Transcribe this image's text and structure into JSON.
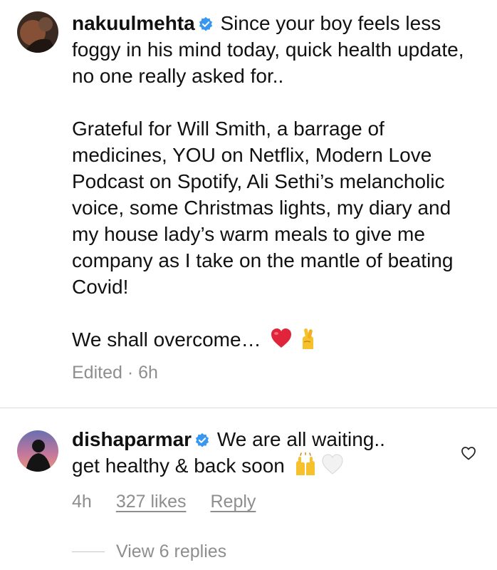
{
  "post": {
    "username": "nakuulmehta",
    "verified_icon": "verified-badge-icon",
    "caption_first": "Since your boy feels less foggy in his mind today, quick health update, no one really asked for..",
    "caption_second": "Grateful for Will Smith, a barrage of medicines, YOU on Netflix, Modern Love Podcast on Spotify, Ali Sethi’s melancholic voice, some Christmas lights, my diary and my house lady’s warm meals to give me company as I take on the mantle of beating Covid!",
    "caption_third": "We shall overcome…",
    "emojis": [
      "red-heart-emoji",
      "crossed-fingers-emoji"
    ],
    "meta": "Edited · 6h"
  },
  "comment": {
    "username": "dishaparmar",
    "verified_icon": "verified-badge-icon",
    "text_first": "We are all waiting..",
    "text_second": "get healthy & back soon",
    "emojis": [
      "raising-hands-emoji",
      "white-heart-emoji"
    ],
    "time": "4h",
    "likes": "327 likes",
    "reply": "Reply",
    "like_icon": "heart-outline-icon"
  },
  "replies": {
    "label": "View 6 replies"
  },
  "colors": {
    "text": "#111111",
    "muted": "#8e8e8e",
    "verified": "#3897f0",
    "divider": "#dbdbdb"
  }
}
